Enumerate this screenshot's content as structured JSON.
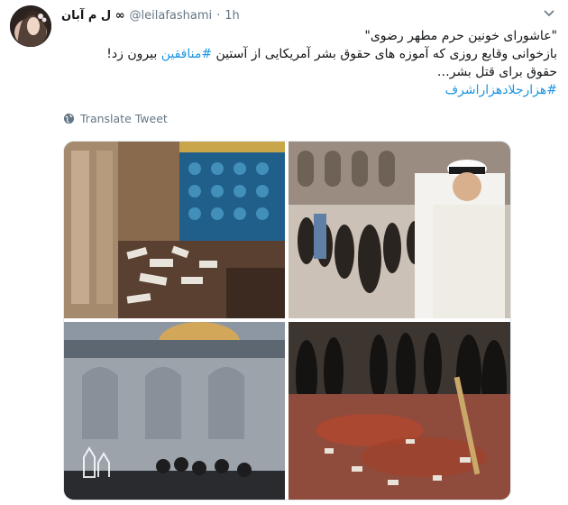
{
  "user": {
    "display_name": "∞ ل م آبان",
    "handle": "@leilafashami",
    "separator": "·",
    "time": "1h"
  },
  "tweet": {
    "line1": "\"عاشورای خونین حرم مطهر رضوی\"",
    "line2_before": "بازخوانی وقایع روزی که آموزه های حقوق بشر آمریکایی از آستین ",
    "line2_hashtag": "#منافقین",
    "line2_after": " بیرون زد!",
    "line3": "حقوق برای قتل بشر…",
    "line4_hashtag": "#هزارجلادهزاراشرف"
  },
  "translate_label": "Translate Tweet",
  "icons": {
    "globe": "globe-icon",
    "caret": "chevron-down-icon"
  },
  "colors": {
    "link": "#1b95e0",
    "secondary_text": "#657786",
    "border": "#e1e8ed"
  }
}
